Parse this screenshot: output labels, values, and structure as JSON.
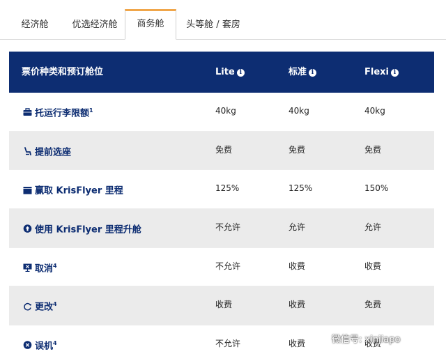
{
  "tabs": [
    {
      "label": "经济舱"
    },
    {
      "label": "优选经济舱"
    },
    {
      "label": "商务舱"
    },
    {
      "label": "头等舱 / 套房"
    }
  ],
  "table": {
    "headers": {
      "fare": "票价种类和预订舱位",
      "lite": "Lite",
      "standard": "标准",
      "flexi": "Flexi",
      "info_glyph": "i"
    },
    "rows": [
      {
        "feature": "托运行李限额",
        "sup": "1",
        "lite": "40kg",
        "standard": "40kg",
        "flexi": "40kg"
      },
      {
        "feature": "提前选座",
        "sup": "",
        "lite": "免费",
        "standard": "免费",
        "flexi": "免费"
      },
      {
        "feature": "赢取 KrisFlyer 里程",
        "sup": "",
        "lite": "125%",
        "standard": "125%",
        "flexi": "150%"
      },
      {
        "feature": "使用 KrisFlyer 里程升舱",
        "sup": "",
        "lite": "不允许",
        "standard": "允许",
        "flexi": "允许"
      },
      {
        "feature": "取消",
        "sup": "4",
        "lite": "不允许",
        "standard": "收费",
        "flexi": "收费"
      },
      {
        "feature": "更改",
        "sup": "4",
        "lite": "收费",
        "standard": "收费",
        "flexi": "免费"
      },
      {
        "feature": "误机",
        "sup": "4",
        "lite": "不允许",
        "standard": "收费",
        "flexi": "收费"
      }
    ]
  },
  "watermark": {
    "text": "微信号: xinjiapo"
  },
  "colors": {
    "header_bg": "#0d2d72",
    "active_tab_accent": "#f0a64a",
    "alt_row": "#ebebeb"
  },
  "icons": [
    "baggage-icon",
    "seat-icon",
    "miles-icon",
    "upgrade-icon",
    "cancel-icon",
    "change-icon",
    "missed-flight-icon"
  ]
}
